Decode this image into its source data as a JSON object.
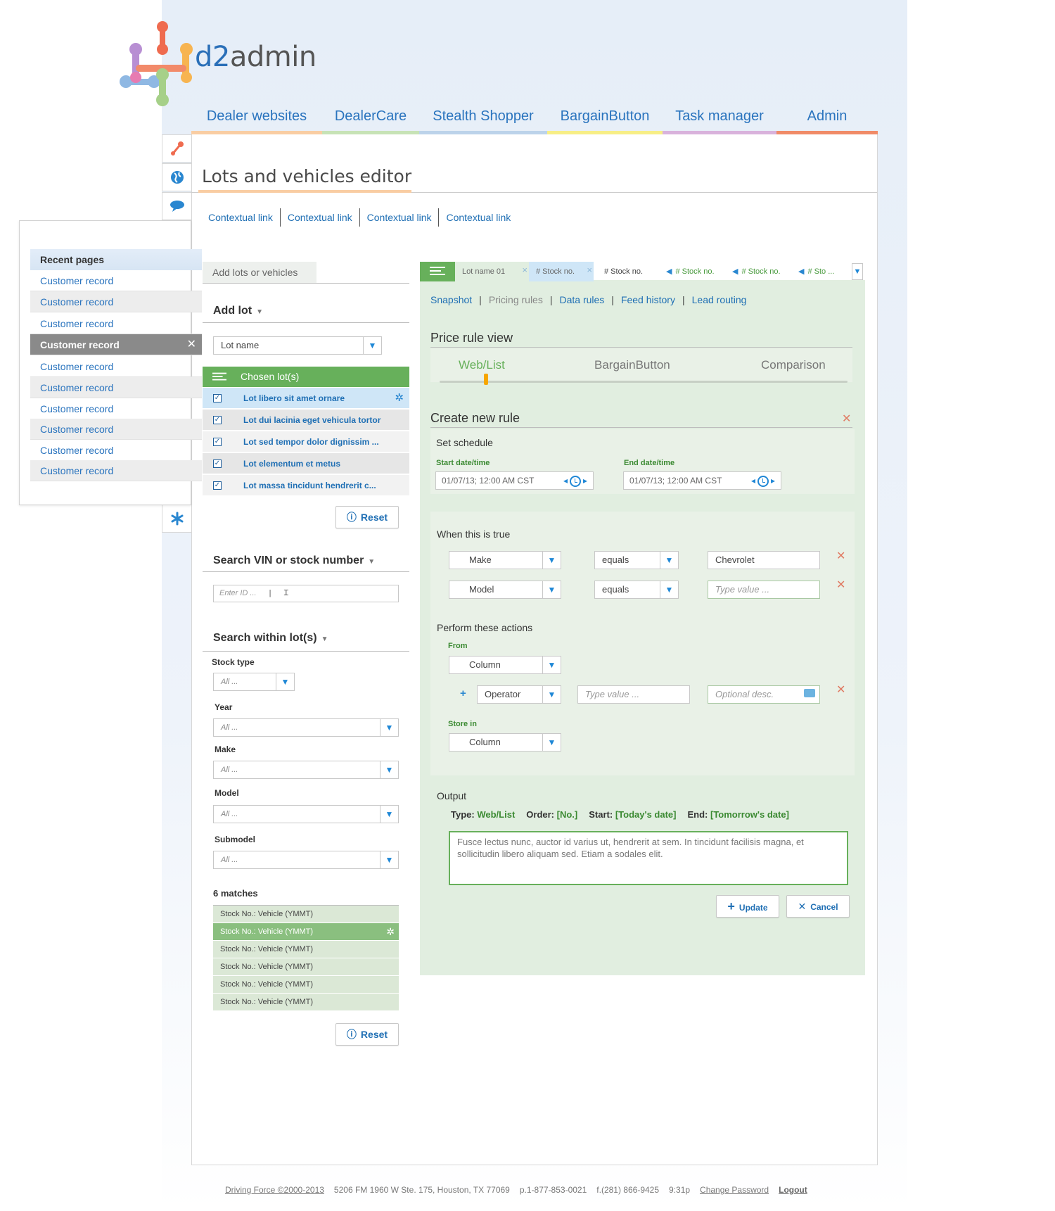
{
  "app": {
    "logo_text": "d2admin"
  },
  "main_nav": [
    {
      "label": "Dealer websites",
      "color": "#f9cda3"
    },
    {
      "label": "DealerCare",
      "color": "#c7e3b6"
    },
    {
      "label": "Stealth Shopper",
      "color": "#bcd3ea"
    },
    {
      "label": "BargainButton",
      "color": "#f7ee86"
    },
    {
      "label": "Task manager",
      "color": "#d9b2dc"
    },
    {
      "label": "Admin",
      "color": "#f08b68"
    }
  ],
  "page": {
    "title": "Lots and vehicles editor"
  },
  "context_links": [
    "Contextual link",
    "Contextual link",
    "Contextual link",
    "Contextual link"
  ],
  "side_icons": [
    "wrench-icon",
    "globe-icon",
    "chat-icon",
    "search-icon",
    "asterisk-icon"
  ],
  "recent_pages": {
    "title": "Recent pages",
    "items": [
      "Customer record",
      "Customer record",
      "Customer record",
      "Customer record",
      "Customer record",
      "Customer record",
      "Customer record",
      "Customer record",
      "Customer record",
      "Customer record"
    ],
    "active_index": 3
  },
  "left": {
    "tab_label": "Add lots or vehicles",
    "add_lot_heading": "Add lot",
    "lot_select_value": "Lot name",
    "chosen_header": "Chosen lot(s)",
    "chosen": [
      "Lot libero sit amet ornare",
      "Lot dui lacinia eget vehicula tortor",
      "Lot sed tempor dolor dignissim ...",
      "Lot elementum et metus",
      "Lot massa tincidunt hendrerit c..."
    ],
    "reset_label": "Reset",
    "search_vin_heading": "Search VIN or stock number",
    "search_vin_placeholder": "Enter ID ...",
    "search_within_heading": "Search within lot(s)",
    "filters": [
      {
        "label": "Stock type",
        "value": "All ..."
      },
      {
        "label": "Year",
        "value": "All ..."
      },
      {
        "label": "Make",
        "value": "All ..."
      },
      {
        "label": "Model",
        "value": "All ..."
      },
      {
        "label": "Submodel",
        "value": "All ..."
      }
    ],
    "matches_heading": "6 matches",
    "matches": [
      "Stock No.: Vehicle (YMMT)",
      "Stock No.: Vehicle (YMMT)",
      "Stock No.: Vehicle (YMMT)",
      "Stock No.: Vehicle (YMMT)",
      "Stock No.: Vehicle (YMMT)",
      "Stock No.: Vehicle (YMMT)"
    ],
    "matches_selected_index": 1,
    "reset2_label": "Reset"
  },
  "right": {
    "tabs": [
      "Lot name 01",
      "# Stock no.",
      "# Stock no.",
      "# Stock no.",
      "# Stock no.",
      "# Sto ..."
    ],
    "subnav": [
      "Snapshot",
      "Pricing rules",
      "Data rules",
      "Feed history",
      "Lead routing"
    ],
    "price_rule_title": "Price rule view",
    "price_tabs": [
      "Web/List",
      "BargainButton",
      "Comparison"
    ],
    "create_rule_title": "Create new rule",
    "schedule": {
      "title": "Set schedule",
      "start_label": "Start date/time",
      "start_value": "01/07/13; 12:00 AM CST",
      "end_label": "End date/time",
      "end_value": "01/07/13; 12:00 AM CST"
    },
    "when_title": "When this is true",
    "conditions": [
      {
        "field": "Make",
        "op": "equals",
        "value": "Chevrolet",
        "placeholder": ""
      },
      {
        "field": "Model",
        "op": "equals",
        "value": "",
        "placeholder": "Type value ..."
      }
    ],
    "actions": {
      "title": "Perform these actions",
      "from_label": "From",
      "from_value": "Column",
      "operator_value": "Operator",
      "type_value_placeholder": "Type value ...",
      "optional_desc_placeholder": "Optional desc.",
      "store_label": "Store in",
      "store_value": "Column"
    },
    "output": {
      "title": "Output",
      "type_label": "Type:",
      "type_value": "Web/List",
      "order_label": "Order:",
      "order_value": "[No.]",
      "start_label": "Start:",
      "start_value": "[Today's date]",
      "end_label": "End:",
      "end_value": "[Tomorrow's date]",
      "text": "Fusce lectus nunc, auctor id varius ut, hendrerit at sem. In tincidunt facilisis magna, et sollicitudin libero aliquam sed. Etiam a sodales elit."
    },
    "update_label": "Update",
    "cancel_label": "Cancel"
  },
  "footer": {
    "copyright": "Driving Force ©2000-2013",
    "address": "5206 FM 1960 W Ste. 175, Houston, TX 77069",
    "phone": "p.1-877-853-0021",
    "fax": "f.(281) 866-9425",
    "time": "9:31p",
    "change_password": "Change Password",
    "logout": "Logout"
  }
}
